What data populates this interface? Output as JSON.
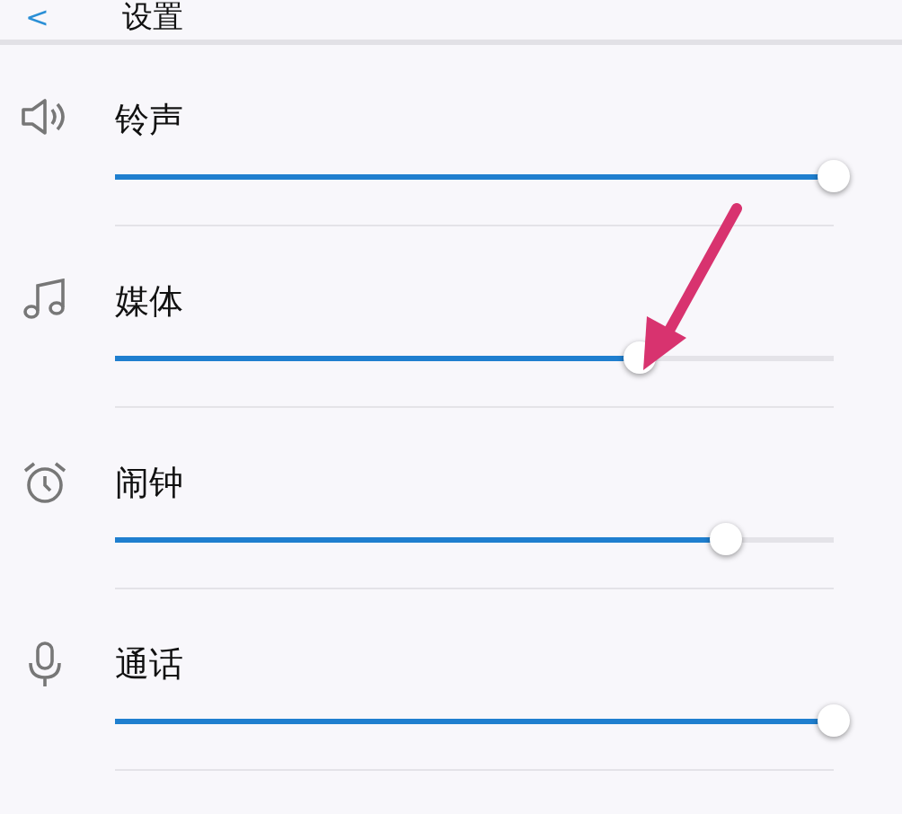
{
  "header": {
    "back": "<",
    "title": "设置"
  },
  "channels": [
    {
      "name": "铃声",
      "level": 1.0
    },
    {
      "name": "媒体",
      "level": 0.73
    },
    {
      "name": "闹钟",
      "level": 0.85
    },
    {
      "name": "通话",
      "level": 1.0
    }
  ]
}
